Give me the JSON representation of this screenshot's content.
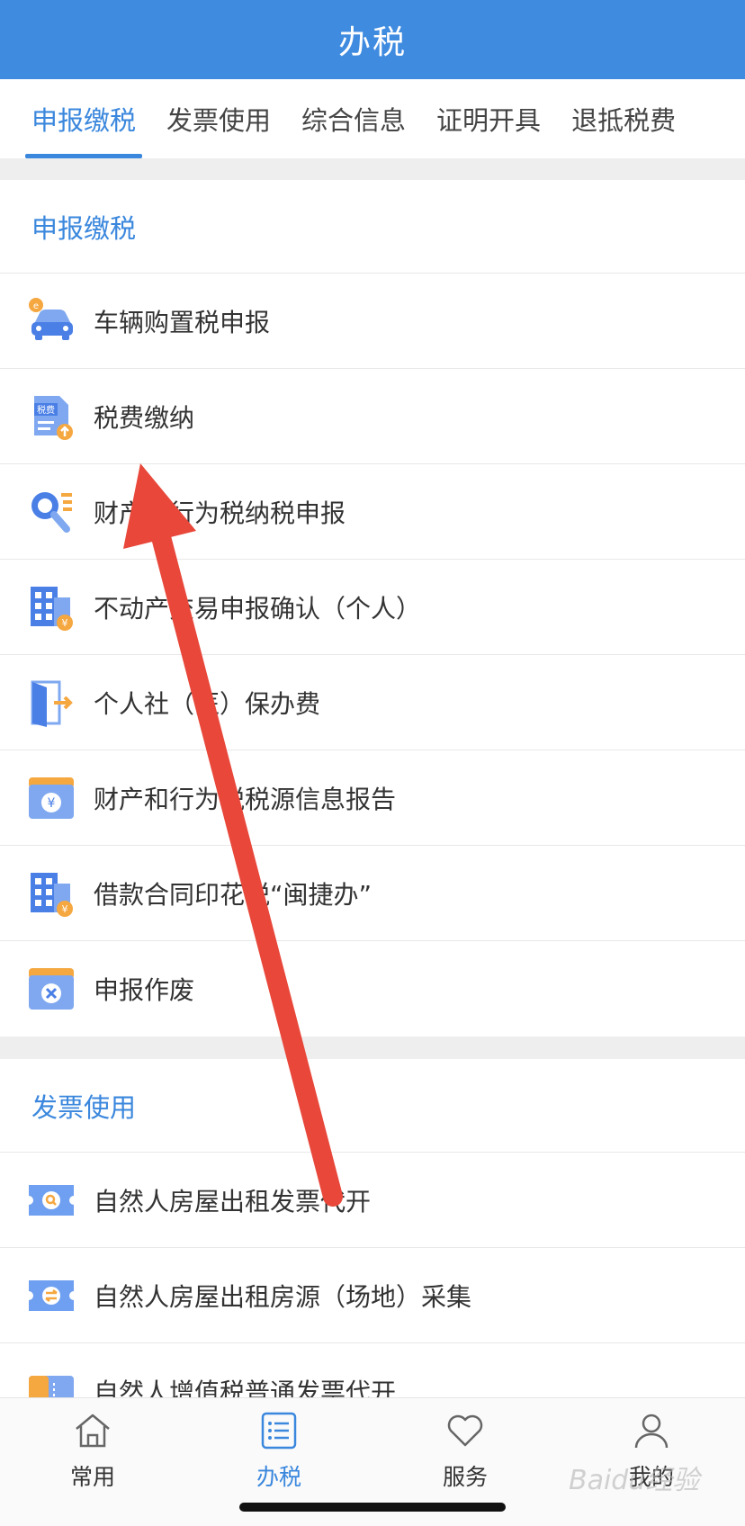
{
  "header": {
    "title": "办税"
  },
  "tabs": [
    {
      "label": "申报缴税",
      "active": true
    },
    {
      "label": "发票使用",
      "active": false
    },
    {
      "label": "综合信息",
      "active": false
    },
    {
      "label": "证明开具",
      "active": false
    },
    {
      "label": "退抵税费",
      "active": false
    }
  ],
  "sections": [
    {
      "title": "申报缴税",
      "items": [
        {
          "label": "车辆购置税申报",
          "icon": "car-icon"
        },
        {
          "label": "税费缴纳",
          "icon": "tax-payment-icon"
        },
        {
          "label": "财产和行为税纳税申报",
          "icon": "search-list-icon"
        },
        {
          "label": "不动产交易申报确认（个人）",
          "icon": "building-yen-icon"
        },
        {
          "label": "个人社（医）保办费",
          "icon": "door-exit-icon"
        },
        {
          "label": "财产和行为税税源信息报告",
          "icon": "browser-yen-icon"
        },
        {
          "label": "借款合同印花税“闽捷办”",
          "icon": "building-yen-icon"
        },
        {
          "label": "申报作废",
          "icon": "browser-cancel-icon"
        }
      ]
    },
    {
      "title": "发票使用",
      "items": [
        {
          "label": "自然人房屋出租发票代开",
          "icon": "ticket-search-icon"
        },
        {
          "label": "自然人房屋出租房源（场地）采集",
          "icon": "ticket-exchange-icon"
        },
        {
          "label": "自然人增值税普通发票代开",
          "icon": "invoice-icon"
        }
      ]
    }
  ],
  "tabbar": [
    {
      "label": "常用",
      "icon": "home-icon",
      "active": false
    },
    {
      "label": "办税",
      "icon": "list-icon",
      "active": true
    },
    {
      "label": "服务",
      "icon": "heart-icon",
      "active": false
    },
    {
      "label": "我的",
      "icon": "user-icon",
      "active": false
    }
  ],
  "watermark": {
    "text": "Baidu经验"
  },
  "colors": {
    "primary": "#3f8be0",
    "accent_text": "#3a87dd",
    "arrow": "#e8473a"
  }
}
